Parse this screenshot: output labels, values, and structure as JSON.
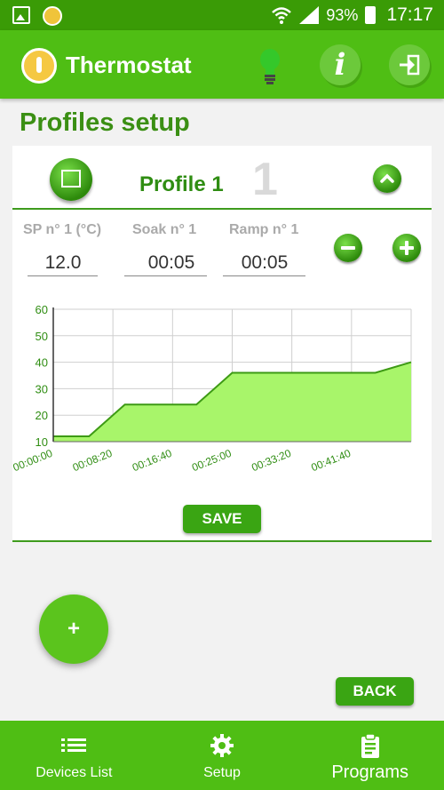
{
  "status_bar": {
    "battery": "93%",
    "time": "17:17"
  },
  "app_bar": {
    "title": "Thermostat"
  },
  "page": {
    "title": "Profiles setup"
  },
  "profile": {
    "name": "Profile 1",
    "number": "1",
    "fields": [
      {
        "label": "SP n° 1 (°C)",
        "value": "12.0"
      },
      {
        "label": "Soak n° 1",
        "value": "00:05"
      },
      {
        "label": "Ramp n° 1",
        "value": "00:05"
      }
    ],
    "save_label": "SAVE"
  },
  "chart_data": {
    "type": "area",
    "x": [
      "00:00:00",
      "00:05:00",
      "00:10:00",
      "00:15:00",
      "00:20:00",
      "00:25:00",
      "00:30:00",
      "00:35:00",
      "00:40:00",
      "00:45:00",
      "00:50:00"
    ],
    "x_minutes": [
      0,
      5,
      10,
      15,
      20,
      25,
      30,
      35,
      40,
      45,
      50
    ],
    "values": [
      12,
      12,
      24,
      24,
      24,
      36,
      36,
      36,
      36,
      36,
      40
    ],
    "xticks": [
      "00:00:00",
      "00:08:20",
      "00:16:40",
      "00:25:00",
      "00:33:20",
      "00:41:40"
    ],
    "xtick_minutes": [
      0,
      8.333,
      16.667,
      25,
      33.333,
      41.667
    ],
    "ylim": [
      10,
      60
    ],
    "yticks": [
      10,
      20,
      30,
      40,
      50,
      60
    ],
    "grid": true,
    "colors": {
      "fill": "#a8f56a",
      "line": "#3d9a14",
      "ticks": "#2f8d12"
    }
  },
  "fab": {
    "label": "+"
  },
  "back_label": "BACK",
  "bottom_nav": [
    {
      "label": "Devices List",
      "icon": "list-icon"
    },
    {
      "label": "Setup",
      "icon": "gear-icon"
    },
    {
      "label": "Programs",
      "icon": "clipboard-icon"
    }
  ]
}
